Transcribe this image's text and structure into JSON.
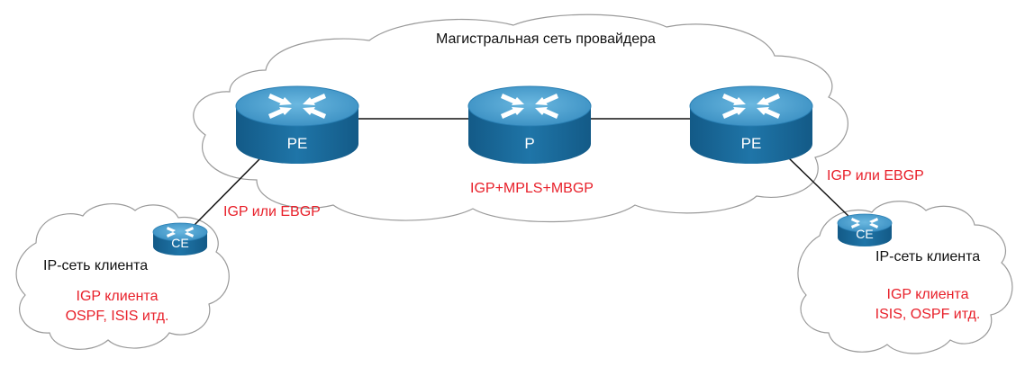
{
  "provider": {
    "label": "Магистральная сеть провайдера",
    "core_protocols": "IGP+MPLS+MBGP"
  },
  "routers": {
    "pe_left": {
      "label": "PE"
    },
    "p_core": {
      "label": "P"
    },
    "pe_right": {
      "label": "PE"
    },
    "ce_left": {
      "label": "CE"
    },
    "ce_right": {
      "label": "CE"
    }
  },
  "links": {
    "left_access": "IGP или EBGP",
    "right_access": "IGP или EBGP"
  },
  "customer_left": {
    "label": "IP-сеть клиента",
    "igp_line1": "IGP клиента",
    "igp_line2": "OSPF, ISIS итд."
  },
  "customer_right": {
    "label": "IP-сеть клиента",
    "igp_line1": "IGP клиента",
    "igp_line2": "ISIS, OSPF итд."
  },
  "colors": {
    "router_top": "#4a9fcc",
    "router_side": "#1b6a9c",
    "protocol_text": "#e8202a",
    "cloud_outline": "#9a9a9a"
  }
}
